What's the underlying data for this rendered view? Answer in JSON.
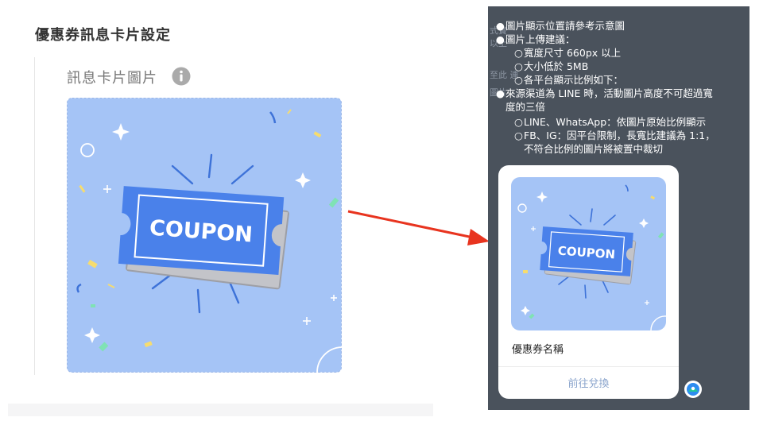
{
  "settings": {
    "section_title": "優惠券訊息卡片設定",
    "field_label": "訊息卡片圖片"
  },
  "coupon_image": {
    "label": "COUPON"
  },
  "preview": {
    "tips": [
      {
        "level": 1,
        "text": "圖片顯示位置請參考示意圖"
      },
      {
        "level": 1,
        "text": "圖片上傳建議："
      },
      {
        "level": 2,
        "text": "寬度尺寸 660px 以上"
      },
      {
        "level": 2,
        "text": "大小低於 5MB"
      },
      {
        "level": 2,
        "text": "各平台顯示比例如下："
      },
      {
        "level": 1,
        "text": "來源渠道為 LINE 時，活動圖片高度不可超過寬"
      },
      {
        "level": 0,
        "text": "度的三倍"
      },
      {
        "level": 2,
        "text": "LINE、WhatsApp：依圖片原始比例顯示"
      },
      {
        "level": 2,
        "text": "FB、IG：因平台限制，長寬比建議為 1:1，"
      },
      {
        "level": 3,
        "text": "不符合比例的圖片將被置中裁切"
      }
    ],
    "background_fragments": [
      "式實",
      "以上",
      "至此 連",
      "圖片"
    ],
    "card": {
      "coupon_name": "優惠券名稱",
      "redeem_label": "前往兌換"
    }
  },
  "colors": {
    "image_bg": "#a5c4f6",
    "ticket_blue": "#4a81ea",
    "arrow_red": "#e8341f",
    "preview_bg": "#4a525c"
  }
}
